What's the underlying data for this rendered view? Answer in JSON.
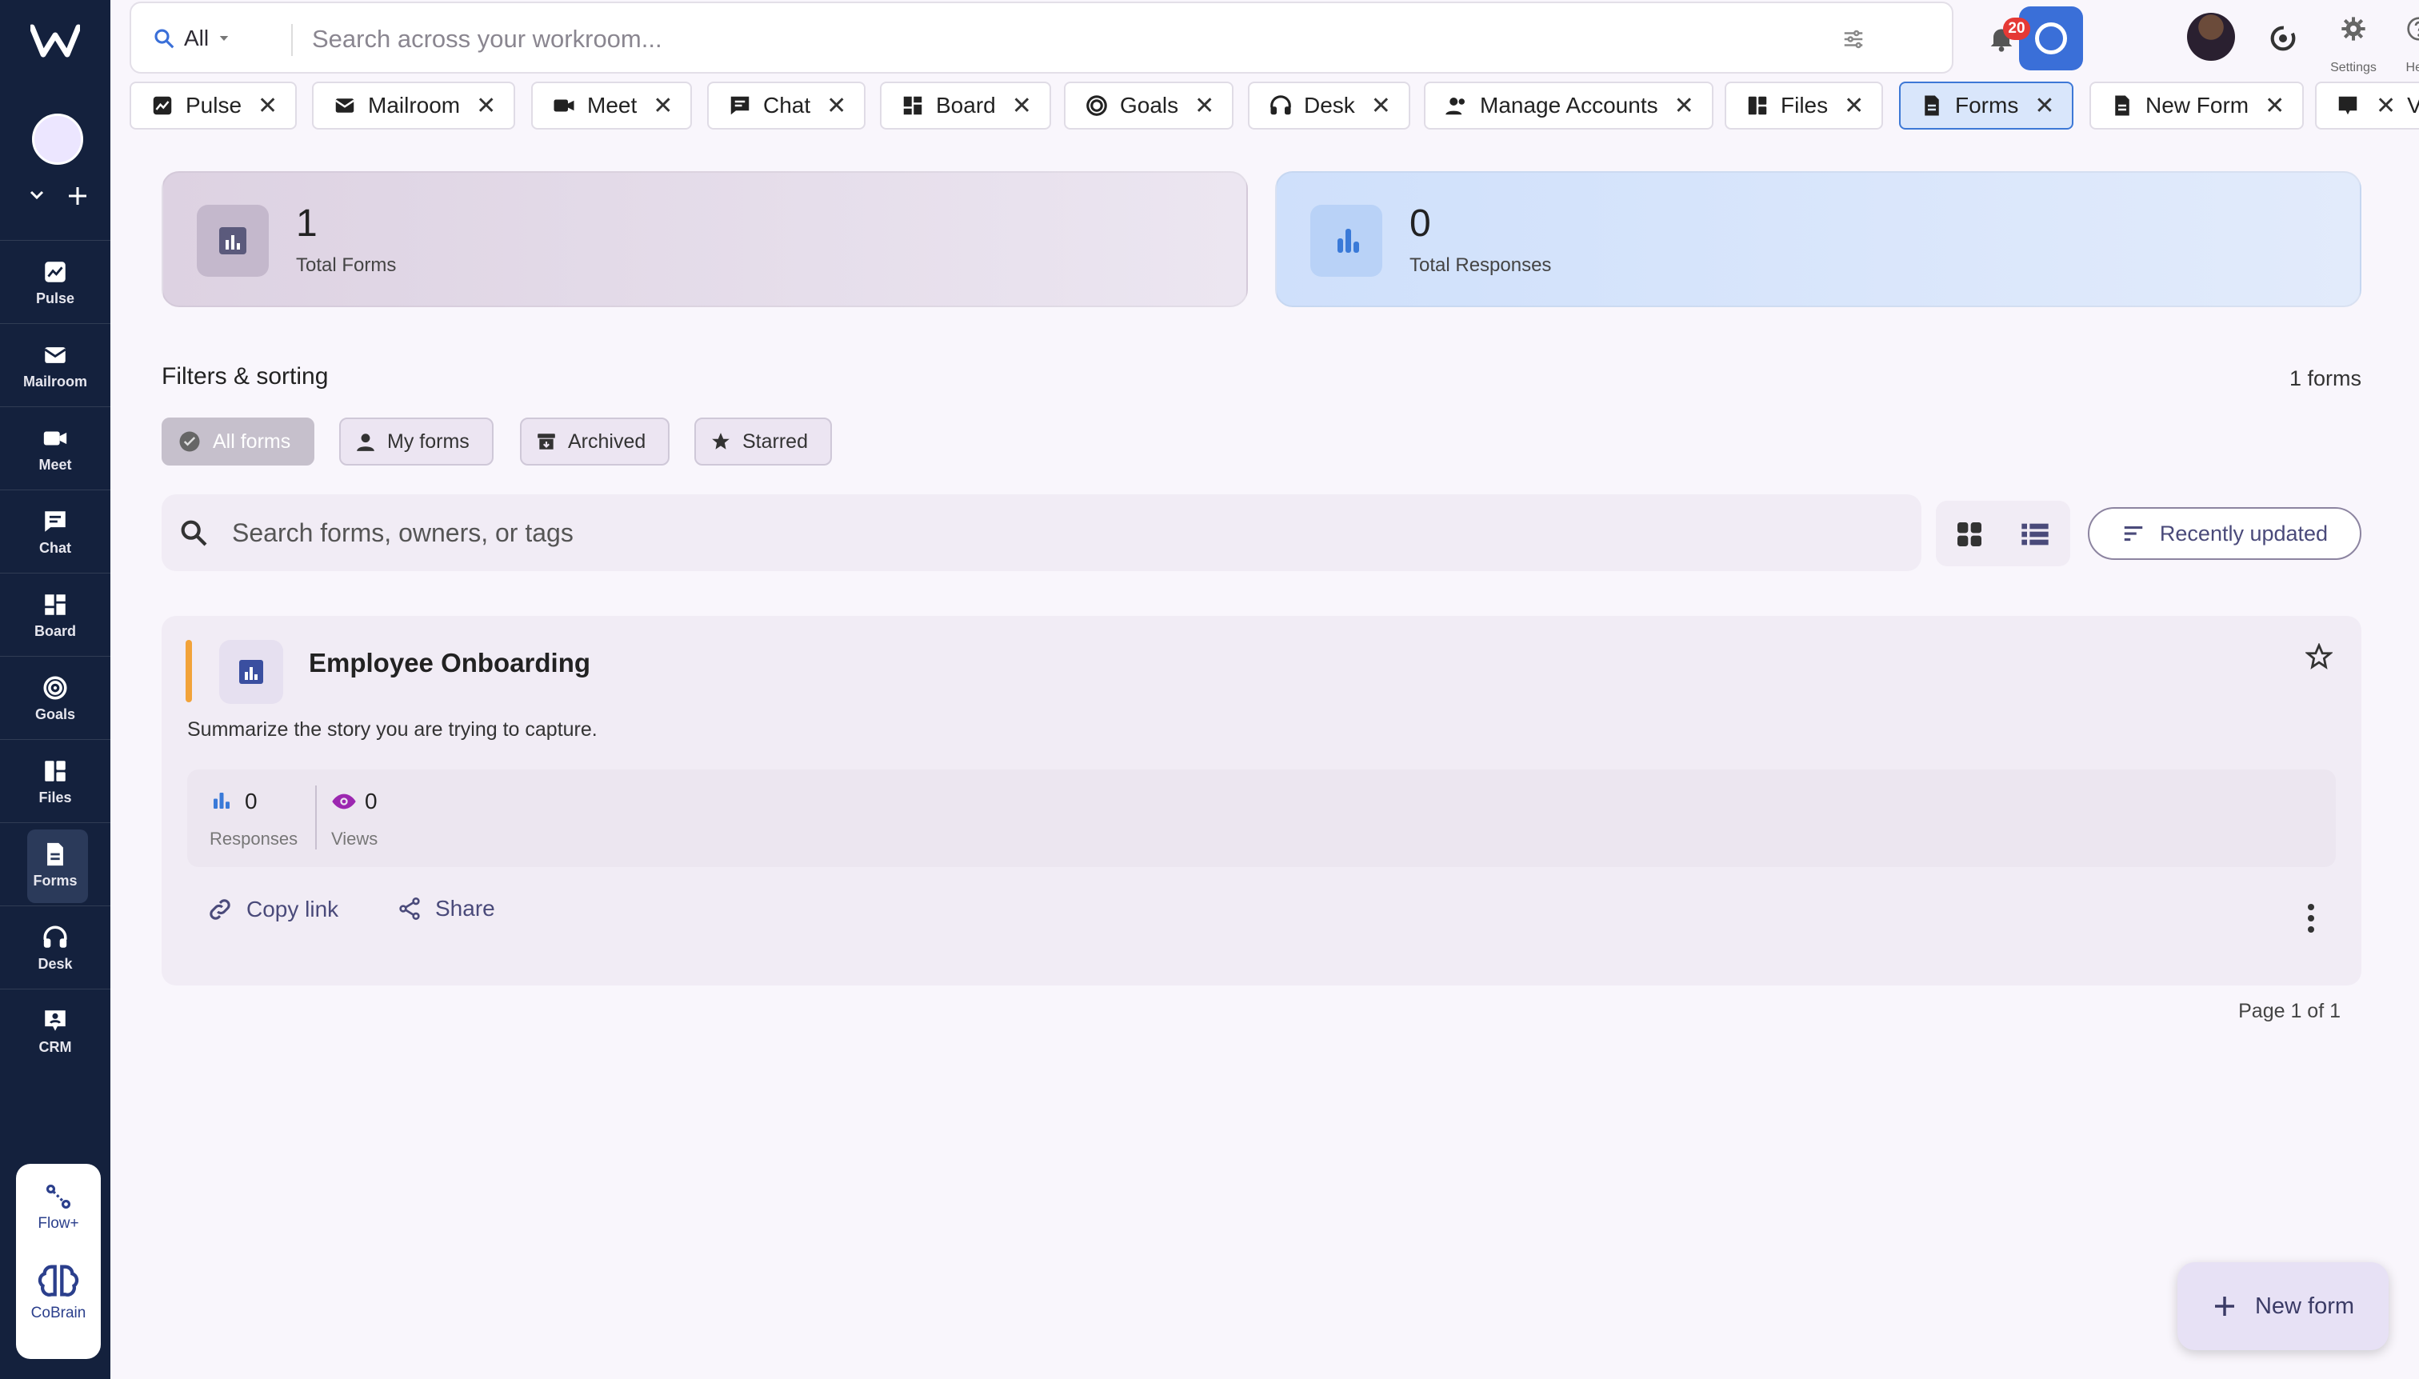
{
  "sidebar": {
    "nav": [
      {
        "label": "Pulse",
        "icon": "pulse-icon"
      },
      {
        "label": "Mailroom",
        "icon": "mailroom-icon"
      },
      {
        "label": "Meet",
        "icon": "video-icon"
      },
      {
        "label": "Chat",
        "icon": "chat-icon"
      },
      {
        "label": "Board",
        "icon": "board-icon"
      },
      {
        "label": "Goals",
        "icon": "goals-icon"
      },
      {
        "label": "Files",
        "icon": "files-icon"
      },
      {
        "label": "Forms",
        "icon": "forms-icon"
      },
      {
        "label": "Desk",
        "icon": "headset-icon"
      },
      {
        "label": "CRM",
        "icon": "crm-icon"
      }
    ],
    "active": "Forms",
    "bottom": {
      "flow": "Flow+",
      "cobrain": "CoBrain"
    }
  },
  "topbar": {
    "scope": "All",
    "search_placeholder": "Search across your workroom...",
    "notifications": "20",
    "settings_label": "Settings",
    "help_label": "Help"
  },
  "tabs": [
    {
      "label": "Pulse"
    },
    {
      "label": "Mailroom"
    },
    {
      "label": "Meet"
    },
    {
      "label": "Chat"
    },
    {
      "label": "Board"
    },
    {
      "label": "Goals"
    },
    {
      "label": "Desk"
    },
    {
      "label": "Manage Accounts"
    },
    {
      "label": "Files"
    },
    {
      "label": "Forms",
      "active": true
    },
    {
      "label": "New Form"
    },
    {
      "label": "V"
    }
  ],
  "stats": {
    "total_forms": {
      "value": "1",
      "label": "Total Forms"
    },
    "total_responses": {
      "value": "0",
      "label": "Total Responses"
    }
  },
  "filters": {
    "title": "Filters & sorting",
    "count": "1 forms",
    "chips": [
      "All forms",
      "My forms",
      "Archived",
      "Starred"
    ],
    "search_placeholder": "Search forms, owners, or tags",
    "sort_label": "Recently updated"
  },
  "form_card": {
    "title": "Employee Onboarding",
    "description": "Summarize the story you are trying to capture.",
    "responses_value": "0",
    "responses_label": "Responses",
    "views_value": "0",
    "views_label": "Views",
    "copy_link": "Copy link",
    "share": "Share",
    "accent_color": "#f2a33a"
  },
  "pager": "Page 1 of 1",
  "fab_label": "New form",
  "colors": {
    "sidebar": "#14213d",
    "primary": "#3a6fd8",
    "active_tab": "#d9e6fb"
  }
}
